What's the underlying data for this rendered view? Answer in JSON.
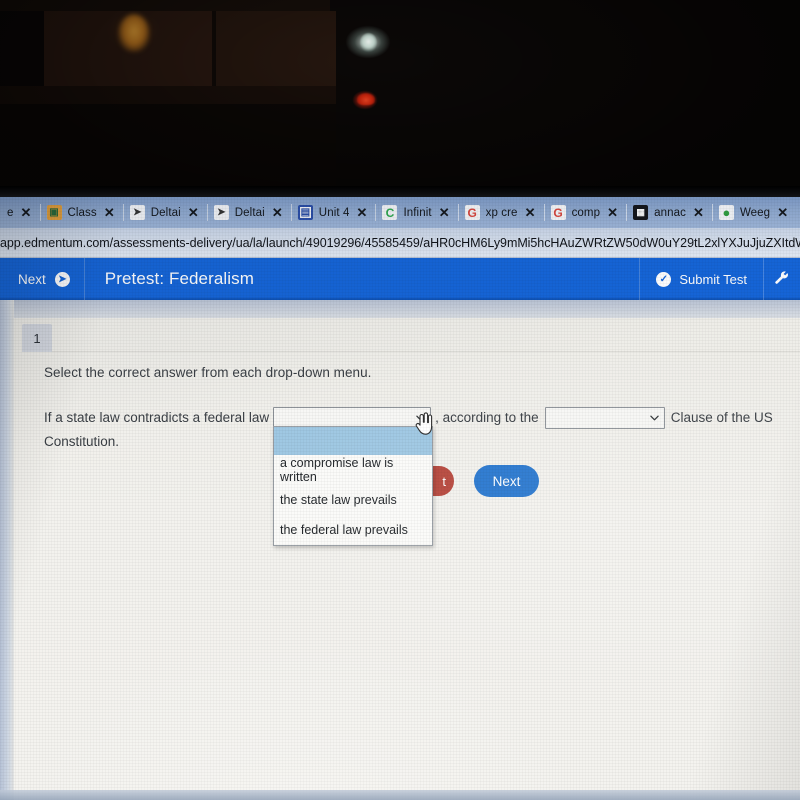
{
  "photo": {
    "scene": "dark-room-above-monitor",
    "lights": [
      "warm-amber-lamp-glow",
      "white-led",
      "red-led"
    ]
  },
  "browser": {
    "tabs": [
      {
        "title": "e",
        "favicon": "generic-icon",
        "close": "✕",
        "truncated_left": true
      },
      {
        "title": "Class",
        "favicon": "class-icon",
        "close": "✕"
      },
      {
        "title": "Deltai",
        "favicon": "delta-icon",
        "close": "✕"
      },
      {
        "title": "Deltai",
        "favicon": "delta-icon",
        "close": "✕"
      },
      {
        "title": "Unit 4",
        "favicon": "unit-icon",
        "close": "✕"
      },
      {
        "title": "Infinit",
        "favicon": "canvas-c-icon",
        "close": "✕"
      },
      {
        "title": "xp cre",
        "favicon": "google-g-icon",
        "close": "✕"
      },
      {
        "title": "comp",
        "favicon": "google-g-icon",
        "close": "✕"
      },
      {
        "title": "annac",
        "favicon": "annac-icon",
        "close": "✕"
      },
      {
        "title": "Weeg",
        "favicon": "weegy-icon",
        "close": "✕"
      }
    ],
    "url": "app.edmentum.com/assessments-delivery/ua/la/launch/49019296/45585459/aHR0cHM6Ly9mMi5hcHAuZWRtZW50dW0uY29tL2xlYXJuJjuZXItdW"
  },
  "app_header": {
    "next_label": "Next",
    "next_icon": "arrow-right-circle-icon",
    "title": "Pretest: Federalism",
    "submit_label": "Submit Test",
    "submit_icon": "check-circle-icon",
    "tools_icon": "wrench-icon",
    "accent_color": "#1565d8"
  },
  "question": {
    "number": "1",
    "instruction": "Select the correct answer from each drop-down menu.",
    "text_before": "If a state law contradicts a federal law",
    "text_middle": ", according to the",
    "text_after": "Clause of the US",
    "text_last_line": "Constitution.",
    "select_1": {
      "value": "",
      "placeholder": "",
      "arrow_icon": "chevron-down-icon",
      "state": "open"
    },
    "select_2": {
      "value": "",
      "placeholder": "",
      "arrow_icon": "chevron-down-icon",
      "state": "closed"
    },
    "dropdown_options": [
      {
        "label": "",
        "highlighted": true
      },
      {
        "label": "a compromise law is written",
        "highlighted": false
      },
      {
        "label": "the state law prevails",
        "highlighted": false
      },
      {
        "label": "the federal law prevails",
        "highlighted": false
      }
    ]
  },
  "actions": {
    "reset_label": "t",
    "reset_color": "#b7473c",
    "next_label": "Next",
    "next_color": "#2676cf"
  },
  "cursor": {
    "type": "pointer-hand-cursor"
  }
}
